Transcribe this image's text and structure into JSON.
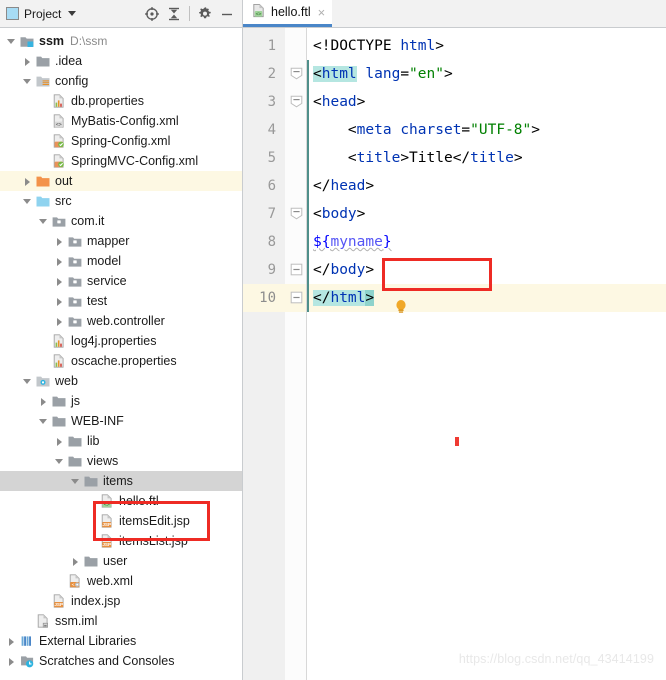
{
  "project_panel": {
    "title": "Project",
    "toolbar": [
      {
        "name": "locate-icon",
        "label": "Select Opened File"
      },
      {
        "name": "collapse-all-icon",
        "label": "Collapse All"
      },
      {
        "name": "gear-icon",
        "label": "Settings"
      },
      {
        "name": "minimize-icon",
        "label": "Hide"
      }
    ],
    "tree": [
      {
        "label": "ssm",
        "note": "D:\\ssm",
        "depth": 0,
        "arrow": "down",
        "icon": "module-icon",
        "bold": true,
        "highlight": "none"
      },
      {
        "label": ".idea",
        "note": "",
        "depth": 1,
        "arrow": "right",
        "icon": "folder-gray-icon",
        "bold": false,
        "highlight": "none"
      },
      {
        "label": "config",
        "note": "",
        "depth": 1,
        "arrow": "down",
        "icon": "folder-res-icon",
        "bold": false,
        "highlight": "none"
      },
      {
        "label": "db.properties",
        "note": "",
        "depth": 2,
        "arrow": "none",
        "icon": "properties-icon",
        "bold": false,
        "highlight": "none"
      },
      {
        "label": "MyBatis-Config.xml",
        "note": "",
        "depth": 2,
        "arrow": "none",
        "icon": "xml-icon",
        "bold": false,
        "highlight": "none"
      },
      {
        "label": "Spring-Config.xml",
        "note": "",
        "depth": 2,
        "arrow": "none",
        "icon": "spring-xml-icon",
        "bold": false,
        "highlight": "none"
      },
      {
        "label": "SpringMVC-Config.xml",
        "note": "",
        "depth": 2,
        "arrow": "none",
        "icon": "spring-xml-icon",
        "bold": false,
        "highlight": "none"
      },
      {
        "label": "out",
        "note": "",
        "depth": 1,
        "arrow": "right",
        "icon": "folder-out-icon",
        "bold": false,
        "highlight": "yellow"
      },
      {
        "label": "src",
        "note": "",
        "depth": 1,
        "arrow": "down",
        "icon": "folder-src-icon",
        "bold": false,
        "highlight": "none"
      },
      {
        "label": "com.it",
        "note": "",
        "depth": 2,
        "arrow": "down",
        "icon": "package-icon",
        "bold": false,
        "highlight": "none"
      },
      {
        "label": "mapper",
        "note": "",
        "depth": 3,
        "arrow": "right",
        "icon": "package-icon",
        "bold": false,
        "highlight": "none"
      },
      {
        "label": "model",
        "note": "",
        "depth": 3,
        "arrow": "right",
        "icon": "package-icon",
        "bold": false,
        "highlight": "none"
      },
      {
        "label": "service",
        "note": "",
        "depth": 3,
        "arrow": "right",
        "icon": "package-icon",
        "bold": false,
        "highlight": "none"
      },
      {
        "label": "test",
        "note": "",
        "depth": 3,
        "arrow": "right",
        "icon": "package-icon",
        "bold": false,
        "highlight": "none"
      },
      {
        "label": "web.controller",
        "note": "",
        "depth": 3,
        "arrow": "right",
        "icon": "package-icon",
        "bold": false,
        "highlight": "none"
      },
      {
        "label": "log4j.properties",
        "note": "",
        "depth": 2,
        "arrow": "none",
        "icon": "properties-icon",
        "bold": false,
        "highlight": "none"
      },
      {
        "label": "oscache.properties",
        "note": "",
        "depth": 2,
        "arrow": "none",
        "icon": "properties-icon",
        "bold": false,
        "highlight": "none"
      },
      {
        "label": "web",
        "note": "",
        "depth": 1,
        "arrow": "down",
        "icon": "folder-web-icon",
        "bold": false,
        "highlight": "none"
      },
      {
        "label": "js",
        "note": "",
        "depth": 2,
        "arrow": "right",
        "icon": "folder-gray-icon",
        "bold": false,
        "highlight": "none"
      },
      {
        "label": "WEB-INF",
        "note": "",
        "depth": 2,
        "arrow": "down",
        "icon": "folder-gray-icon",
        "bold": false,
        "highlight": "none"
      },
      {
        "label": "lib",
        "note": "",
        "depth": 3,
        "arrow": "right",
        "icon": "folder-gray-icon",
        "bold": false,
        "highlight": "none"
      },
      {
        "label": "views",
        "note": "",
        "depth": 3,
        "arrow": "down",
        "icon": "folder-gray-icon",
        "bold": false,
        "highlight": "none"
      },
      {
        "label": "items",
        "note": "",
        "depth": 4,
        "arrow": "down",
        "icon": "folder-gray-icon",
        "bold": false,
        "highlight": "gray"
      },
      {
        "label": "hello.ftl",
        "note": "",
        "depth": 5,
        "arrow": "none",
        "icon": "ftl-icon",
        "bold": false,
        "highlight": "none"
      },
      {
        "label": "itemsEdit.jsp",
        "note": "",
        "depth": 5,
        "arrow": "none",
        "icon": "jsp-icon",
        "bold": false,
        "highlight": "none"
      },
      {
        "label": "itemsList.jsp",
        "note": "",
        "depth": 5,
        "arrow": "none",
        "icon": "jsp-icon",
        "bold": false,
        "highlight": "none"
      },
      {
        "label": "user",
        "note": "",
        "depth": 4,
        "arrow": "right",
        "icon": "folder-gray-icon",
        "bold": false,
        "highlight": "none"
      },
      {
        "label": "web.xml",
        "note": "",
        "depth": 3,
        "arrow": "none",
        "icon": "webxml-icon",
        "bold": false,
        "highlight": "none"
      },
      {
        "label": "index.jsp",
        "note": "",
        "depth": 2,
        "arrow": "none",
        "icon": "jsp-icon",
        "bold": false,
        "highlight": "none"
      },
      {
        "label": "ssm.iml",
        "note": "",
        "depth": 1,
        "arrow": "none",
        "icon": "iml-icon",
        "bold": false,
        "highlight": "none"
      },
      {
        "label": "External Libraries",
        "note": "",
        "depth": 0,
        "arrow": "right",
        "icon": "libraries-icon",
        "bold": false,
        "highlight": "none"
      },
      {
        "label": "Scratches and Consoles",
        "note": "",
        "depth": 0,
        "arrow": "right",
        "icon": "scratches-icon",
        "bold": false,
        "highlight": "none"
      }
    ]
  },
  "editor": {
    "tab": {
      "name": "hello.ftl",
      "icon": "ftl-icon",
      "close": "×"
    },
    "line_numbers": [
      "1",
      "2",
      "3",
      "4",
      "5",
      "6",
      "7",
      "8",
      "9",
      "10"
    ],
    "current_line": 10,
    "lines": [
      {
        "n": "1",
        "text": "<!DOCTYPE html>"
      },
      {
        "n": "2",
        "text": "<html lang=\"en\">"
      },
      {
        "n": "3",
        "text": "<head>"
      },
      {
        "n": "4",
        "text": "    <meta charset=\"UTF-8\">"
      },
      {
        "n": "5",
        "text": "    <title>Title</title>"
      },
      {
        "n": "6",
        "text": "</head>"
      },
      {
        "n": "7",
        "text": "<body>"
      },
      {
        "n": "8",
        "text": "${myname}"
      },
      {
        "n": "9",
        "text": "</body>"
      },
      {
        "n": "10",
        "text": "</html>"
      }
    ],
    "annotations": [
      {
        "name": "code-red-highlight-box",
        "target": "${myname}"
      },
      {
        "name": "tree-red-highlight-box",
        "target": "items / hello.ftl"
      }
    ]
  },
  "watermark": {
    "text": "https://blog.csdn.net/qq_43414199"
  },
  "colors": {
    "accent": "#4a86c8",
    "annotation_red": "#ee2b24",
    "caret_row": "#fdf8e3",
    "selection_gray": "#d4d4d4",
    "match_cyan": "#b5e6e1",
    "tag_blue": "#0033b3",
    "string_green": "#008000"
  }
}
